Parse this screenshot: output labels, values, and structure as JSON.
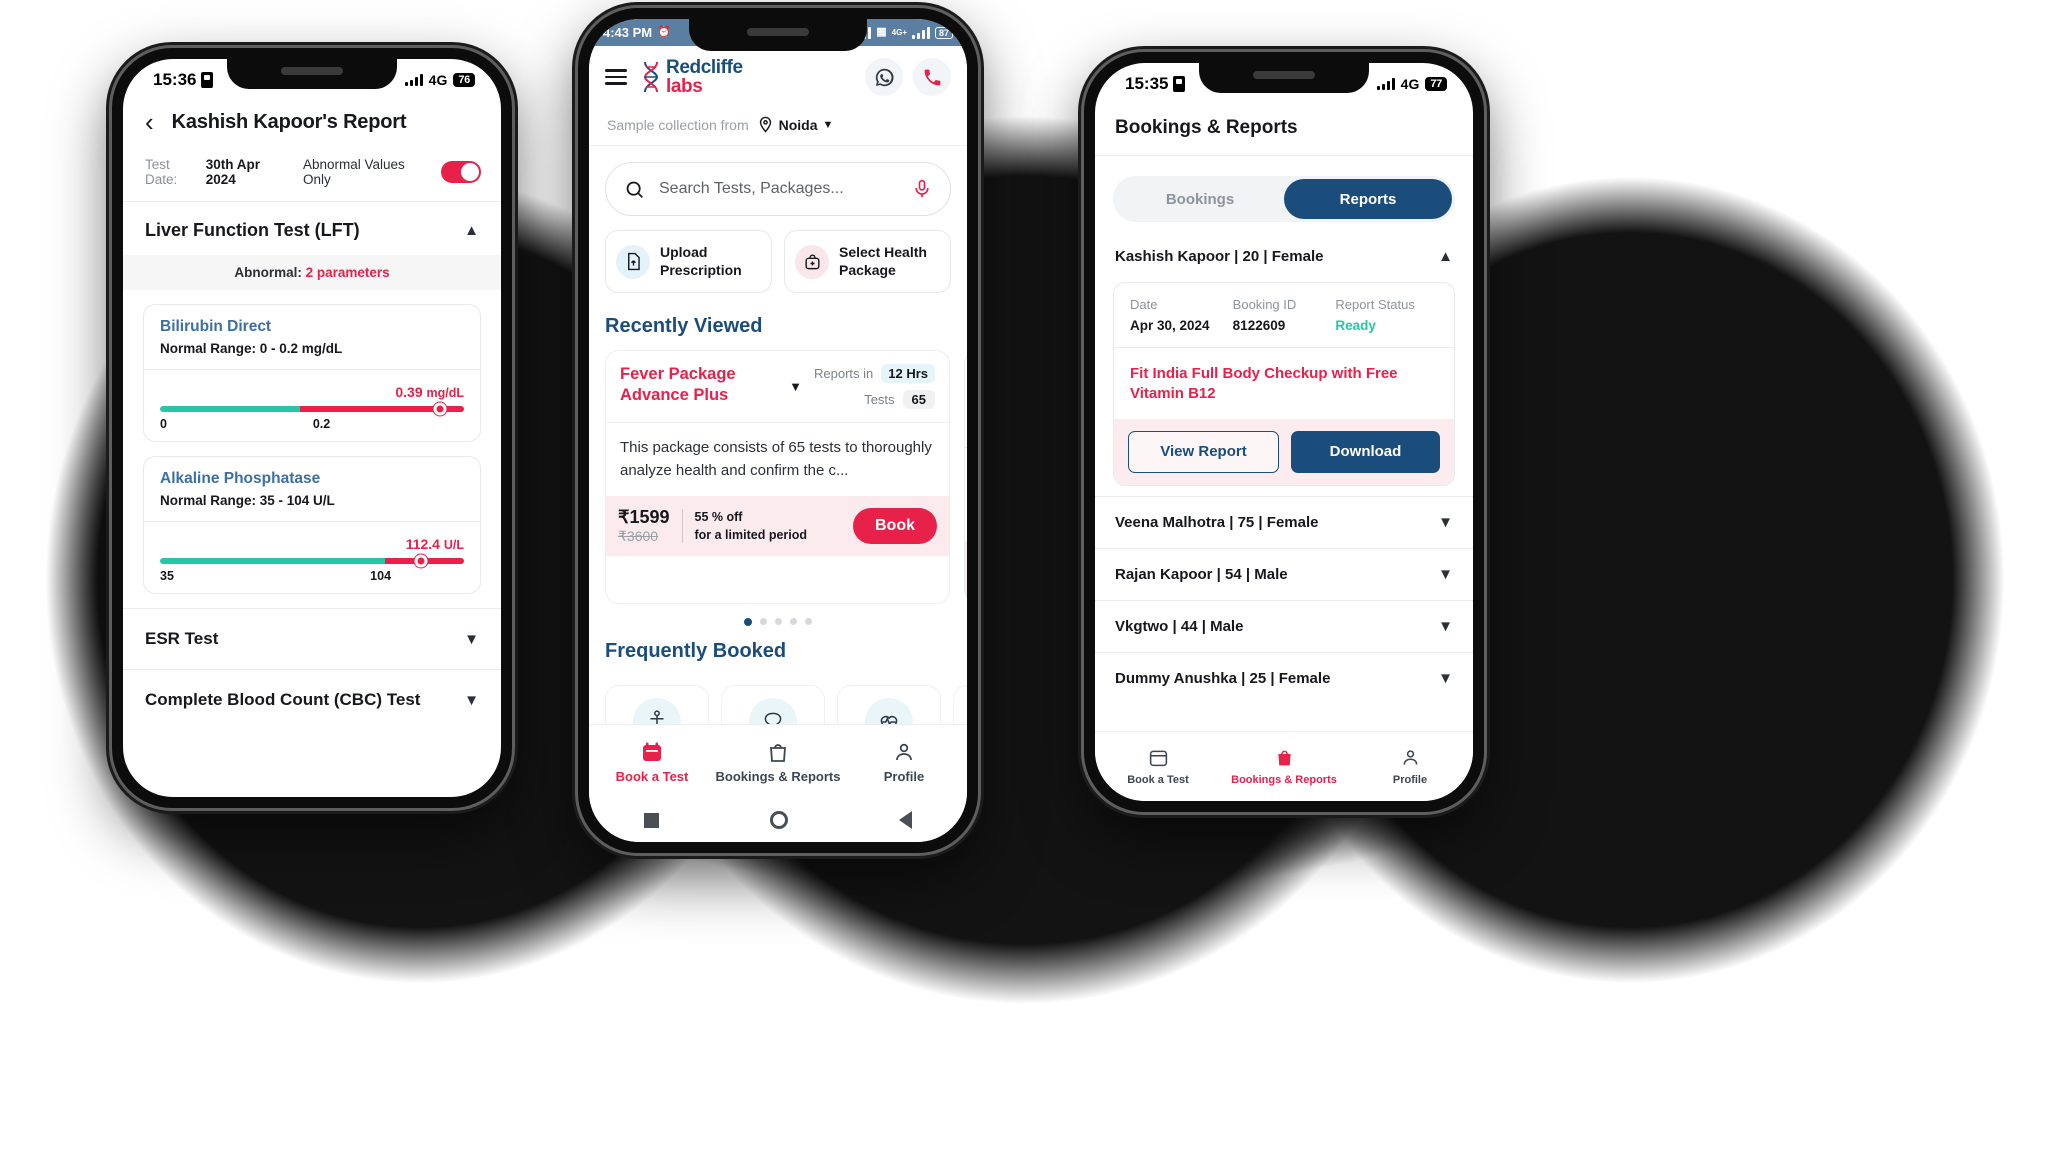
{
  "left_phone": {
    "status": {
      "time": "15:36",
      "network": "4G",
      "battery": "76"
    },
    "header": {
      "back_icon": "chevron-left-icon",
      "title": "Kashish Kapoor's Report"
    },
    "subbar": {
      "test_date_label": "Test Date:",
      "test_date_value": "30th Apr 2024",
      "toggle_label": "Abnormal Values Only",
      "toggle_on": true
    },
    "section": {
      "title": "Liver Function Test (LFT)",
      "expanded": true,
      "abnormal_prefix": "Abnormal:",
      "abnormal_count": "2 parameters"
    },
    "parameters": [
      {
        "name": "Bilirubin Direct",
        "range_label": "Normal Range: 0 - 0.2 mg/dL",
        "value": "0.39",
        "unit": "mg/dL",
        "tick_low": "0",
        "tick_high": "0.2",
        "green_pct": 46,
        "knob_pct": 92
      },
      {
        "name": "Alkaline Phosphatase",
        "range_label": "Normal Range: 35 - 104 U/L",
        "value": "112.4",
        "unit": "U/L",
        "tick_low": "35",
        "tick_high": "104",
        "green_pct": 74,
        "knob_pct": 86
      }
    ],
    "collapsed_sections": [
      {
        "title": "ESR Test"
      },
      {
        "title": "Complete Blood Count (CBC) Test"
      }
    ]
  },
  "center_phone": {
    "status": {
      "time": "4:43 PM",
      "battery": "87",
      "network": "4G+"
    },
    "brand": {
      "line1": "Redcliffe",
      "line2": "labs"
    },
    "header_icons": {
      "menu": "hamburger-icon",
      "whatsapp": "whatsapp-icon",
      "call": "phone-call-icon"
    },
    "sample_collection": {
      "label": "Sample collection from",
      "city": "Noida"
    },
    "search": {
      "placeholder": "Search Tests, Packages...",
      "value": ""
    },
    "actions": [
      {
        "label": "Upload Prescription",
        "icon": "upload-file-icon"
      },
      {
        "label": "Select Health Package",
        "icon": "health-package-icon"
      }
    ],
    "recently_viewed_title": "Recently Viewed",
    "package": {
      "name": "Fever Package Advance Plus",
      "reports_in_label": "Reports in",
      "reports_in_value": "12 Hrs",
      "tests_label": "Tests",
      "tests_value": "65",
      "description": "This package consists of 65 tests to thoroughly analyze health and confirm the c...",
      "price": "₹1599",
      "old_price": "₹3600",
      "discount": "55 % off",
      "discount_sub": "for a limited period",
      "book_label": "Book"
    },
    "carousel_dots": 5,
    "carousel_active": 0,
    "frequently_booked_title": "Frequently Booked",
    "frequently_booked_icons": [
      "full-body-icon",
      "thyroid-icon",
      "heart-pulse-icon",
      "more-icon"
    ],
    "bottom_nav": [
      {
        "label": "Book a Test",
        "icon": "calendar-icon",
        "active": true
      },
      {
        "label": "Bookings & Reports",
        "icon": "bag-icon",
        "active": false
      },
      {
        "label": "Profile",
        "icon": "person-icon",
        "active": false
      }
    ]
  },
  "right_phone": {
    "status": {
      "time": "15:35",
      "network": "4G",
      "battery": "77"
    },
    "title": "Bookings & Reports",
    "segments": [
      {
        "label": "Bookings",
        "active": false
      },
      {
        "label": "Reports",
        "active": true
      }
    ],
    "patient": {
      "name_line": "Kashish Kapoor | 20 | Female",
      "expanded": true
    },
    "report": {
      "headers": [
        "Date",
        "Booking ID",
        "Report Status"
      ],
      "values": [
        "Apr 30, 2024",
        "8122609",
        "Ready"
      ],
      "package_name": "Fit India Full Body Checkup with Free Vitamin B12",
      "view_label": "View Report",
      "download_label": "Download"
    },
    "other_patients": [
      "Veena Malhotra | 75 | Female",
      "Rajan Kapoor | 54 | Male",
      "Vkgtwo | 44 | Male",
      "Dummy Anushka | 25 | Female"
    ],
    "bottom_nav": [
      {
        "label": "Book a Test",
        "icon": "calendar-icon",
        "active": false
      },
      {
        "label": "Bookings & Reports",
        "icon": "bag-icon",
        "active": true
      },
      {
        "label": "Profile",
        "icon": "person-icon",
        "active": false
      }
    ]
  },
  "colors": {
    "brand_red": "#e8214b",
    "brand_blue": "#1a4d7c",
    "green": "#26c6a6",
    "android_statusbar": "#5b7ea3"
  }
}
